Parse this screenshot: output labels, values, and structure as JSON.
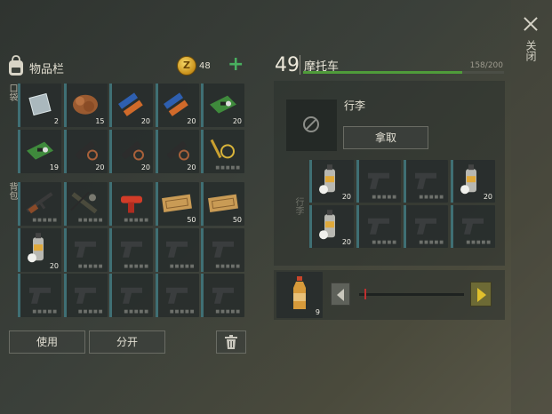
{
  "colors": {
    "accent_green": "#4f9c3a",
    "slot_bar": "#3f6f74",
    "knob": "#c03030",
    "arrow": "#e0c02c",
    "coin": "#f6d766"
  },
  "header": {
    "title": "物品栏",
    "coin_symbol": "Z",
    "coin_count": "48",
    "add_icon": "plus-icon"
  },
  "labels": {
    "pocket": "口袋",
    "backpack": "背包",
    "luggage": "行李",
    "close": "关闭"
  },
  "pocket_slots": [
    {
      "icon": "metal-sheet",
      "count": "2"
    },
    {
      "icon": "meat-chunk",
      "count": "15"
    },
    {
      "icon": "battery",
      "count": "20"
    },
    {
      "icon": "battery",
      "count": "20"
    },
    {
      "icon": "circuit-board",
      "count": "20"
    },
    {
      "icon": "circuit-board",
      "count": "19"
    },
    {
      "icon": "flashlight-parts",
      "count": "20"
    },
    {
      "icon": "flashlight-parts",
      "count": "20"
    },
    {
      "icon": "flashlight-parts",
      "count": "20"
    },
    {
      "icon": "magnifier-tool",
      "count": ""
    }
  ],
  "backpack_slots": [
    {
      "icon": "rifle",
      "count": ""
    },
    {
      "icon": "crossbow",
      "count": ""
    },
    {
      "icon": "flare-gun",
      "count": ""
    },
    {
      "icon": "ticket",
      "count": "50"
    },
    {
      "icon": "ticket",
      "count": "50"
    },
    {
      "icon": "spray-can",
      "count": "20"
    },
    {
      "icon": "pistol",
      "count": ""
    },
    {
      "icon": "pistol",
      "count": ""
    },
    {
      "icon": "pistol",
      "count": ""
    },
    {
      "icon": "pistol",
      "count": ""
    },
    {
      "icon": "pistol",
      "count": ""
    },
    {
      "icon": "pistol",
      "count": ""
    },
    {
      "icon": "pistol",
      "count": ""
    },
    {
      "icon": "pistol",
      "count": ""
    },
    {
      "icon": "pistol",
      "count": ""
    }
  ],
  "actions": {
    "use": "使用",
    "split": "分开",
    "trash_icon": "trash-icon"
  },
  "vehicle": {
    "capacity_used": "49",
    "name": "摩托车",
    "capacity_text": "158/200",
    "capacity_fraction": 0.79
  },
  "selected": {
    "title": "行李",
    "take": "拿取"
  },
  "luggage_slots": [
    {
      "icon": "spray-can",
      "count": "20"
    },
    {
      "icon": "pistol",
      "count": ""
    },
    {
      "icon": "pistol",
      "count": ""
    },
    {
      "icon": "spray-can",
      "count": "20"
    },
    {
      "icon": "spray-can",
      "count": "20"
    },
    {
      "icon": "pistol",
      "count": ""
    },
    {
      "icon": "pistol",
      "count": ""
    },
    {
      "icon": "pistol",
      "count": ""
    }
  ],
  "transfer": {
    "item_icon": "bottle",
    "count": "9",
    "slider_value": 0.05
  }
}
